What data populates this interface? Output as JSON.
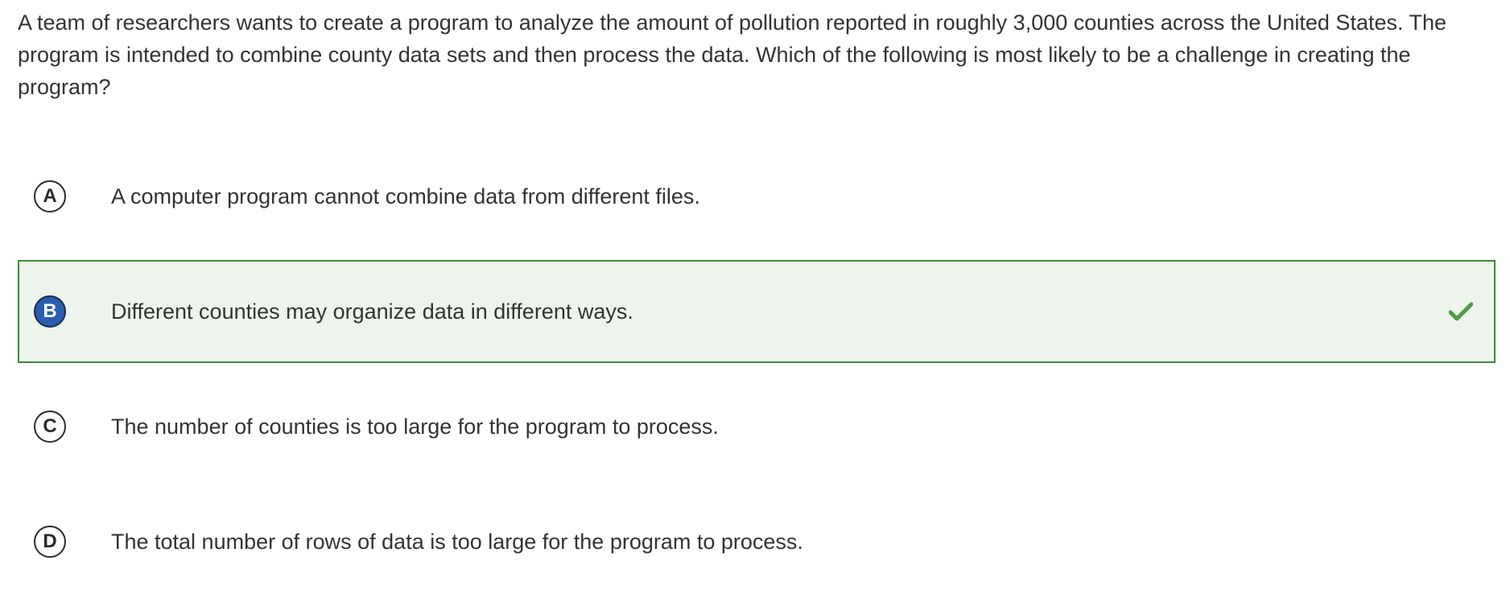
{
  "question": {
    "text": "A team of researchers wants to create a program to analyze the amount of pollution reported in roughly 3,000 counties across the United States. The program is intended to combine county data sets and then process the data. Which of the following is most likely to be a challenge in creating the program?"
  },
  "choices": [
    {
      "letter": "A",
      "text": "A computer program cannot combine data from different files.",
      "state": "default"
    },
    {
      "letter": "B",
      "text": "Different counties may organize data in different ways.",
      "state": "correct",
      "icon": "checkmark-icon"
    },
    {
      "letter": "C",
      "text": "The number of counties is too large for the program to process.",
      "state": "default"
    },
    {
      "letter": "D",
      "text": "The total number of rows of data is too large for the program to process.",
      "state": "default"
    }
  ],
  "colors": {
    "correct_background": "#edf4ec",
    "correct_border": "#3a8d35",
    "check_icon": "#4f9a45",
    "selected_letter_fill": "#2a5db0",
    "text": "#333333"
  }
}
